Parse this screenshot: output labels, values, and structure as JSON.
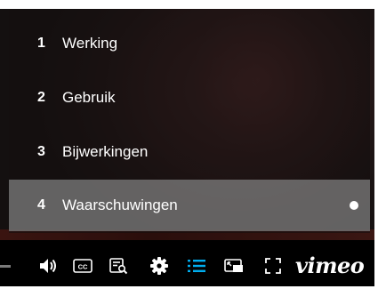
{
  "menu": {
    "items": [
      {
        "number": "1",
        "label": "Werking"
      },
      {
        "number": "2",
        "label": "Gebruik"
      },
      {
        "number": "3",
        "label": "Bijwerkingen"
      },
      {
        "number": "4",
        "label": "Waarschuwingen",
        "selected": true
      }
    ]
  },
  "controls": {
    "icons": [
      "volume-icon",
      "cc-icon",
      "transcript-icon",
      "settings-icon",
      "chapters-icon",
      "picture-in-picture-icon",
      "fullscreen-icon"
    ],
    "brand": "vimeo",
    "accent_color": "#00adef"
  }
}
